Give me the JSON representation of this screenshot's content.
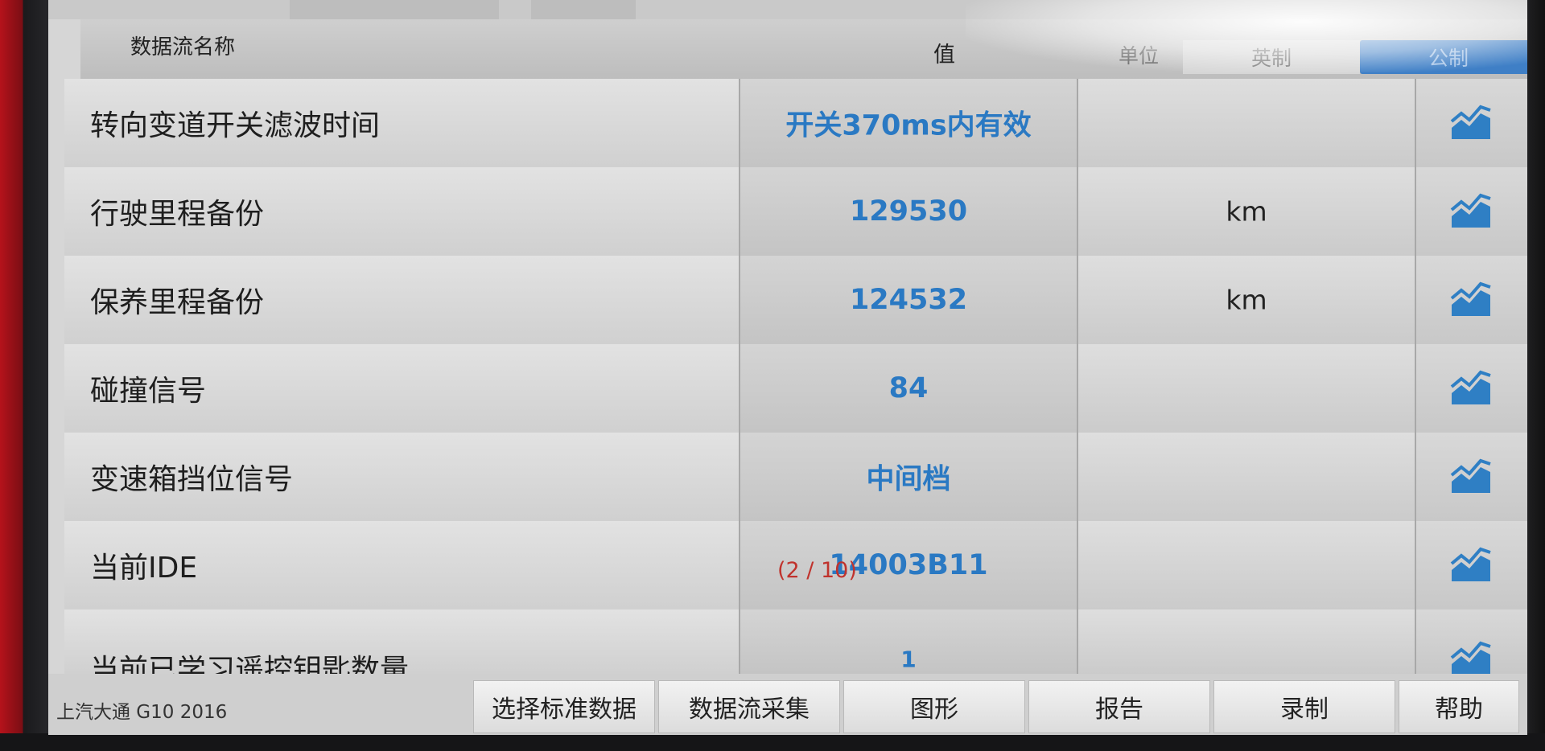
{
  "header": {
    "name_col": "数据流名称",
    "value_col": "值",
    "unit_col": "单位",
    "unit_imperial": "英制",
    "unit_metric": "公制"
  },
  "rows": [
    {
      "name": "转向变道开关滤波时间",
      "value": "开关370ms内有效",
      "unit": ""
    },
    {
      "name": "行驶里程备份",
      "value": "129530",
      "unit": "km"
    },
    {
      "name": "保养里程备份",
      "value": "124532",
      "unit": "km"
    },
    {
      "name": "碰撞信号",
      "value": "84",
      "unit": ""
    },
    {
      "name": "变速箱挡位信号",
      "value": "中间档",
      "unit": ""
    },
    {
      "name": "当前IDE",
      "value": "14003B11",
      "unit": ""
    },
    {
      "name": "当前已学习遥控钥匙数量",
      "value": "1",
      "unit": ""
    }
  ],
  "page_indicator": "(2 / 10)",
  "vehicle": "上汽大通 G10 2016",
  "toolbar": {
    "select_std": "选择标准数据",
    "capture": "数据流采集",
    "graph": "图形",
    "report": "报告",
    "record": "录制",
    "help": "帮助"
  },
  "colors": {
    "accent": "#3f7fc6",
    "value_text": "#2a79c3",
    "page_indicator": "#c0332d"
  },
  "icons": {
    "row_action": "line-chart-icon"
  }
}
